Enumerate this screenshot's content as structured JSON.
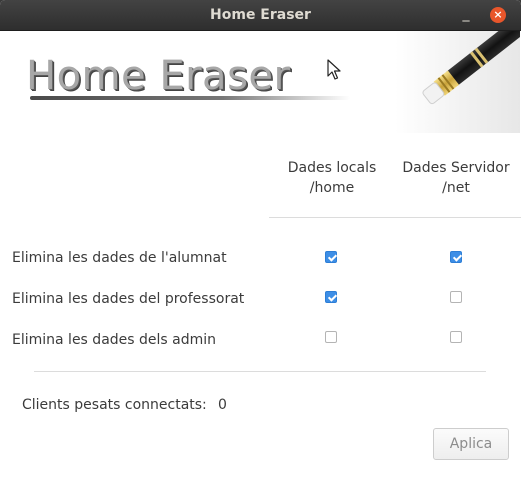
{
  "window": {
    "title": "Home Eraser",
    "minimize_glyph": "_",
    "close_glyph": "×"
  },
  "banner": {
    "logo_text": "Home Eraser",
    "icon": "pencil-eraser-icon"
  },
  "table": {
    "columns": [
      {
        "line1": "Dades locals",
        "line2": "/home"
      },
      {
        "line1": "Dades Servidor",
        "line2": "/net"
      }
    ],
    "rows": [
      {
        "label": "Elimina les dades de l'alumnat",
        "local": true,
        "server": true
      },
      {
        "label": "Elimina les dades del professorat",
        "local": true,
        "server": false
      },
      {
        "label": "Elimina les dades dels admin",
        "local": false,
        "server": false
      }
    ]
  },
  "status": {
    "clients_label": "Clients pesats connectats:",
    "clients_count": "0"
  },
  "actions": {
    "apply_label": "Aplica"
  },
  "colors": {
    "accent": "#3d8ee6",
    "close_button": "#e8562b",
    "titlebar": "#3b3b3b"
  }
}
